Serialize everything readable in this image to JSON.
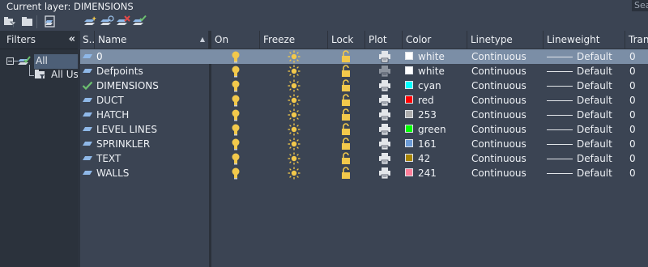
{
  "title": "Current layer: DIMENSIONS",
  "search_text": "Search",
  "toolbar": {
    "buttons": [
      {
        "name": "new-property-filter-button",
        "icon": "new-property-filter-icon"
      },
      {
        "name": "new-group-filter-button",
        "icon": "new-group-filter-icon"
      },
      {
        "name": "layer-states-manager-button",
        "icon": "layer-states-icon"
      },
      {
        "name": "new-layer-button",
        "icon": "new-layer-icon"
      },
      {
        "name": "new-layer-vp-frozen-button",
        "icon": "new-layer-vp-frozen-icon"
      },
      {
        "name": "delete-layer-button",
        "icon": "delete-layer-icon"
      },
      {
        "name": "set-current-button",
        "icon": "set-current-icon"
      }
    ]
  },
  "filters": {
    "header": "Filters",
    "collapse_glyph": "«",
    "tree": [
      {
        "label": "All",
        "selected": true
      },
      {
        "label": "All Used Layers"
      }
    ]
  },
  "columns": {
    "status": "S...",
    "name": "Name",
    "on": "On",
    "freeze": "Freeze",
    "lock": "Lock",
    "plot": "Plot",
    "color": "Color",
    "linetype": "Linetype",
    "lineweight": "Lineweight",
    "transparency": "Transparency"
  },
  "colors": {
    "bg": "#3b4453",
    "selected_row": "#7b8ea6",
    "panel": "#2b323c",
    "bulb": "#f2c84b",
    "current_check": "#6cc070"
  },
  "rows": [
    {
      "name": "0",
      "color_name": "white",
      "color_hex": "#ffffff",
      "linetype": "Continuous",
      "lineweight": "Default",
      "transparency": "0",
      "selected": true,
      "current": false,
      "plot_enabled": true
    },
    {
      "name": "Defpoints",
      "color_name": "white",
      "color_hex": "#ffffff",
      "linetype": "Continuous",
      "lineweight": "Default",
      "transparency": "0",
      "current": false,
      "plot_enabled": false
    },
    {
      "name": "DIMENSIONS",
      "color_name": "cyan",
      "color_hex": "#00ffff",
      "linetype": "Continuous",
      "lineweight": "Default",
      "transparency": "0",
      "current": true,
      "plot_enabled": true
    },
    {
      "name": "DUCT",
      "color_name": "red",
      "color_hex": "#ff0000",
      "linetype": "Continuous",
      "lineweight": "Default",
      "transparency": "0",
      "current": false,
      "plot_enabled": true
    },
    {
      "name": "HATCH",
      "color_name": "253",
      "color_hex": "#adadad",
      "linetype": "Continuous",
      "lineweight": "Default",
      "transparency": "0",
      "current": false,
      "plot_enabled": true
    },
    {
      "name": "LEVEL LINES",
      "color_name": "green",
      "color_hex": "#00ff00",
      "linetype": "Continuous",
      "lineweight": "Default",
      "transparency": "0",
      "current": false,
      "plot_enabled": true
    },
    {
      "name": "SPRINKLER",
      "color_name": "161",
      "color_hex": "#6c9bd6",
      "linetype": "Continuous",
      "lineweight": "Default",
      "transparency": "0",
      "current": false,
      "plot_enabled": true
    },
    {
      "name": "TEXT",
      "color_name": "42",
      "color_hex": "#a88400",
      "linetype": "Continuous",
      "lineweight": "Default",
      "transparency": "0",
      "current": false,
      "plot_enabled": true
    },
    {
      "name": "WALLS",
      "color_name": "241",
      "color_hex": "#ff7f9a",
      "linetype": "Continuous",
      "lineweight": "Default",
      "transparency": "0",
      "current": false,
      "plot_enabled": true
    }
  ]
}
